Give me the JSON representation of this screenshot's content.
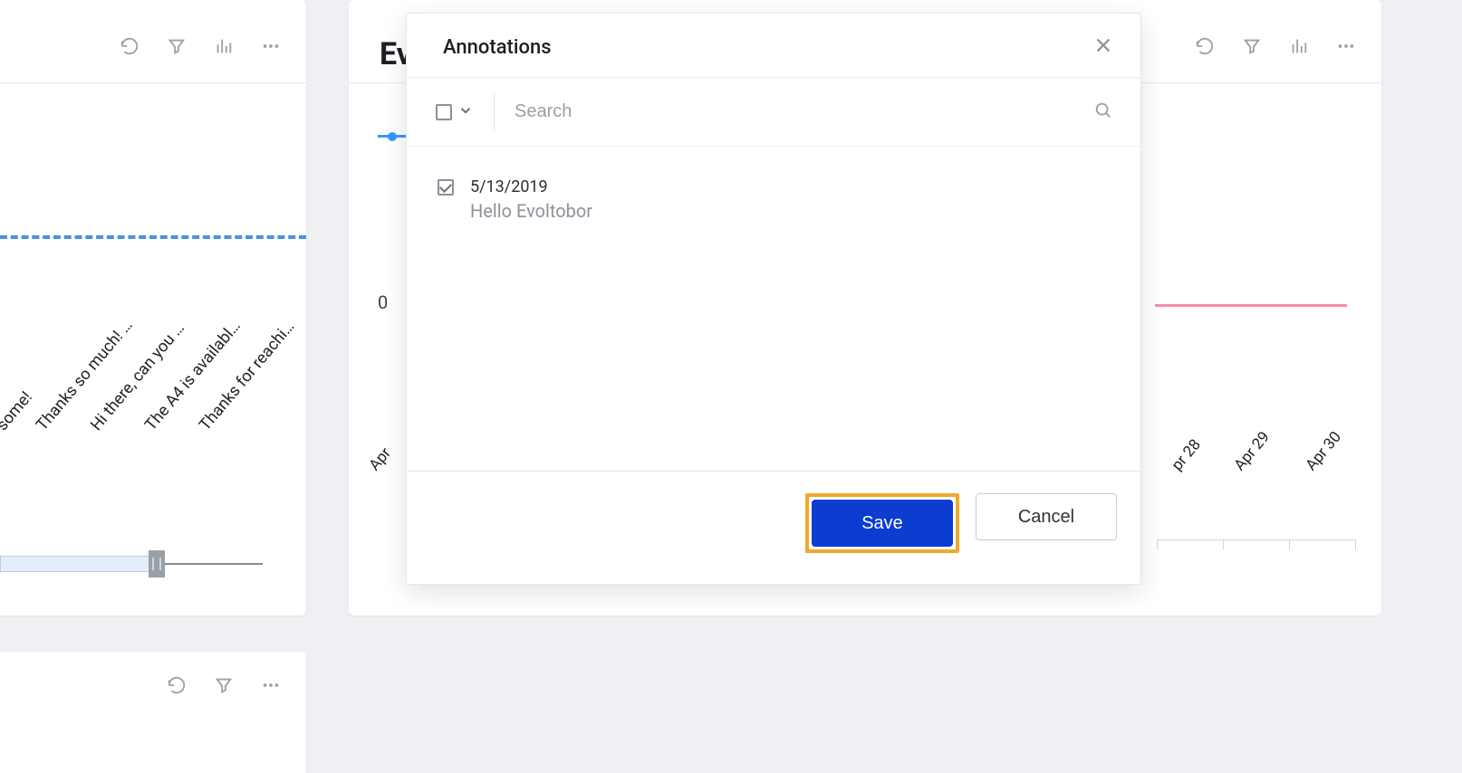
{
  "left_card": {
    "labels": [
      "some!",
      "Thanks so much! …",
      "Hi there, can you …",
      "The A4 is availabl…",
      "Thanks for reachi…"
    ]
  },
  "right_card": {
    "title_partial": "Ev",
    "y_zero": "0",
    "xticks_right": [
      "pr 28",
      "Apr 29",
      "Apr 30"
    ],
    "xtick_left": "Apr"
  },
  "modal": {
    "title": "Annotations",
    "search_placeholder": "Search",
    "items": [
      {
        "date": "5/13/2019",
        "title": "Hello Evoltobor",
        "checked": true
      }
    ],
    "save_label": "Save",
    "cancel_label": "Cancel"
  }
}
